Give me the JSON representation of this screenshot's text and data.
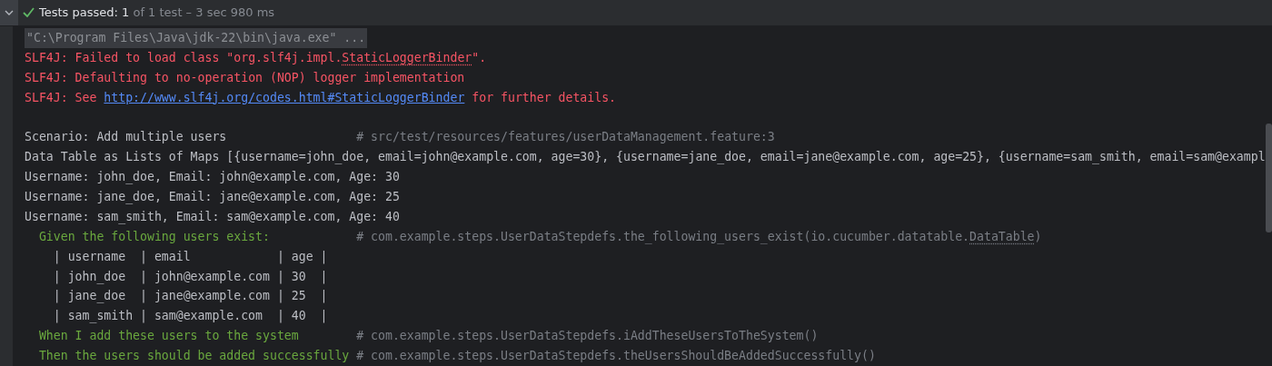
{
  "status_bar": {
    "passed": true,
    "label": "Tests passed:",
    "count": "1",
    "detail": "of 1 test – 3 sec 980 ms"
  },
  "console": [
    {
      "kind": "command",
      "parts": [
        {
          "text": "\"C:\\Program Files\\Java\\jdk-22\\bin\\java.exe\" ..."
        }
      ]
    },
    {
      "kind": "error",
      "parts": [
        {
          "text": "SLF4J: Failed to load class \"org.slf4j.impl."
        },
        {
          "text": "StaticLoggerBinder",
          "kind": "dotted"
        },
        {
          "text": "\"."
        }
      ]
    },
    {
      "kind": "error",
      "parts": [
        {
          "text": "SLF4J: Defaulting to no-operation (NOP) logger implementation"
        }
      ]
    },
    {
      "kind": "error",
      "parts": [
        {
          "text": "SLF4J: See "
        },
        {
          "text": "http://www.slf4j.org/codes.html#StaticLoggerBinder",
          "kind": "link"
        },
        {
          "text": " for further details."
        }
      ]
    },
    {
      "kind": "blank"
    },
    {
      "kind": "plain",
      "parts": [
        {
          "text": "Scenario: Add multiple users"
        }
      ],
      "comment": [
        {
          "text": "# src/test/resources/features/userDataManagement.feature:3"
        }
      ]
    },
    {
      "kind": "plain",
      "parts": [
        {
          "text": "Data Table as Lists of Maps [{username=john_doe, email=john@example.com, age=30}, {username=jane_doe, email=jane@example.com, age=25}, {username=sam_smith, email=sam@exampl"
        }
      ]
    },
    {
      "kind": "plain",
      "parts": [
        {
          "text": "Username: john_doe, Email: john@example.com, Age: 30"
        }
      ]
    },
    {
      "kind": "plain",
      "parts": [
        {
          "text": "Username: jane_doe, Email: jane@example.com, Age: 25"
        }
      ]
    },
    {
      "kind": "plain",
      "parts": [
        {
          "text": "Username: sam_smith, Email: sam@example.com, Age: 40"
        }
      ]
    },
    {
      "kind": "step",
      "parts": [
        {
          "text": "Given the following users exist:"
        }
      ],
      "comment": [
        {
          "text": "# com.example.steps.UserDataStepdefs.the_following_users_exist(io.cucumber.datatable."
        },
        {
          "text": "DataTable",
          "kind": "dotted"
        },
        {
          "text": ")"
        }
      ]
    },
    {
      "kind": "table",
      "parts": [
        {
          "text": "| username  | email            | age |"
        }
      ]
    },
    {
      "kind": "table",
      "parts": [
        {
          "text": "| john_doe  | john@example.com | 30  |"
        }
      ]
    },
    {
      "kind": "table",
      "parts": [
        {
          "text": "| jane_doe  | jane@example.com | 25  |"
        }
      ]
    },
    {
      "kind": "table",
      "parts": [
        {
          "text": "| sam_smith | sam@example.com  | 40  |"
        }
      ]
    },
    {
      "kind": "step",
      "parts": [
        {
          "text": "When I add these users to the system"
        }
      ],
      "comment": [
        {
          "text": "# com.example.steps.UserDataStepdefs.iAddTheseUsersToTheSystem()"
        }
      ]
    },
    {
      "kind": "step",
      "parts": [
        {
          "text": "Then the users should be added successfully"
        }
      ],
      "comment": [
        {
          "text": "# com.example.steps.UserDataStepdefs.theUsersShouldBeAddedSuccessfully()"
        }
      ]
    }
  ]
}
